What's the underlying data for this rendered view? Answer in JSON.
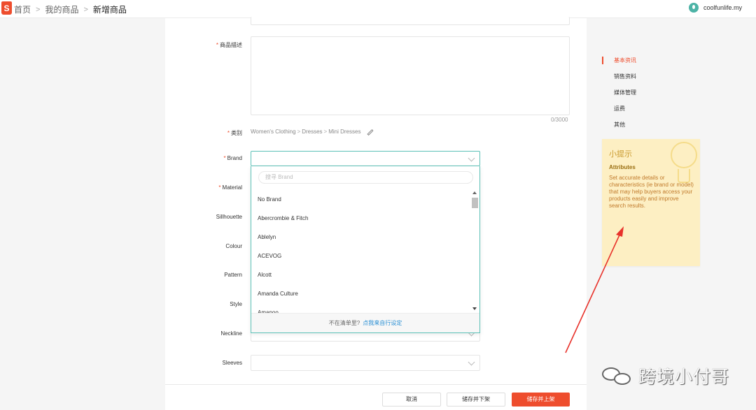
{
  "header": {
    "logo_letter": "S",
    "breadcrumb": [
      "首页",
      "我的商品",
      "新增商品"
    ],
    "username": "coolfunlife.my"
  },
  "form": {
    "description": {
      "label": "商品描述",
      "counter": "0/3000"
    },
    "category": {
      "label": "类别",
      "path": [
        "Women's Clothing",
        "Dresses",
        "Mini Dresses"
      ]
    },
    "attributes": [
      {
        "label": "Brand",
        "required": true
      },
      {
        "label": "Material",
        "required": true
      },
      {
        "label": "Sillhouette",
        "required": false
      },
      {
        "label": "Colour",
        "required": false
      },
      {
        "label": "Pattern",
        "required": false
      },
      {
        "label": "Style",
        "required": false
      },
      {
        "label": "Neckline",
        "required": false
      },
      {
        "label": "Sleeves",
        "required": false
      }
    ]
  },
  "brand_dropdown": {
    "search_placeholder": "搜寻 Brand",
    "options": [
      "No Brand",
      "Abercrombie & Fitch",
      "Ablelyn",
      "ACEVOG",
      "Alcott",
      "Amanda Culture",
      "Amanoo"
    ],
    "footer_text": "不在清单里?",
    "footer_link": "点我来自行设定"
  },
  "actions": {
    "cancel": "取消",
    "save_unlist": "储存并下架",
    "save_publish": "储存并上架"
  },
  "side_nav": {
    "items": [
      "基本资讯",
      "销售资料",
      "媒体管理",
      "运费",
      "其他"
    ],
    "active_index": 0
  },
  "tips": {
    "title": "小提示",
    "subtitle": "Attributes",
    "body": "Set accurate details or characteristics (ie brand or model) that may help buyers access your products easily and improve search results."
  },
  "watermark": "跨境小付哥",
  "colors": {
    "brand": "#ee4d2d",
    "focus": "#5cc1b7",
    "link": "#2a8fd4",
    "tips_bg": "#fdefc3",
    "annotation_arrow": "#e8322b"
  }
}
